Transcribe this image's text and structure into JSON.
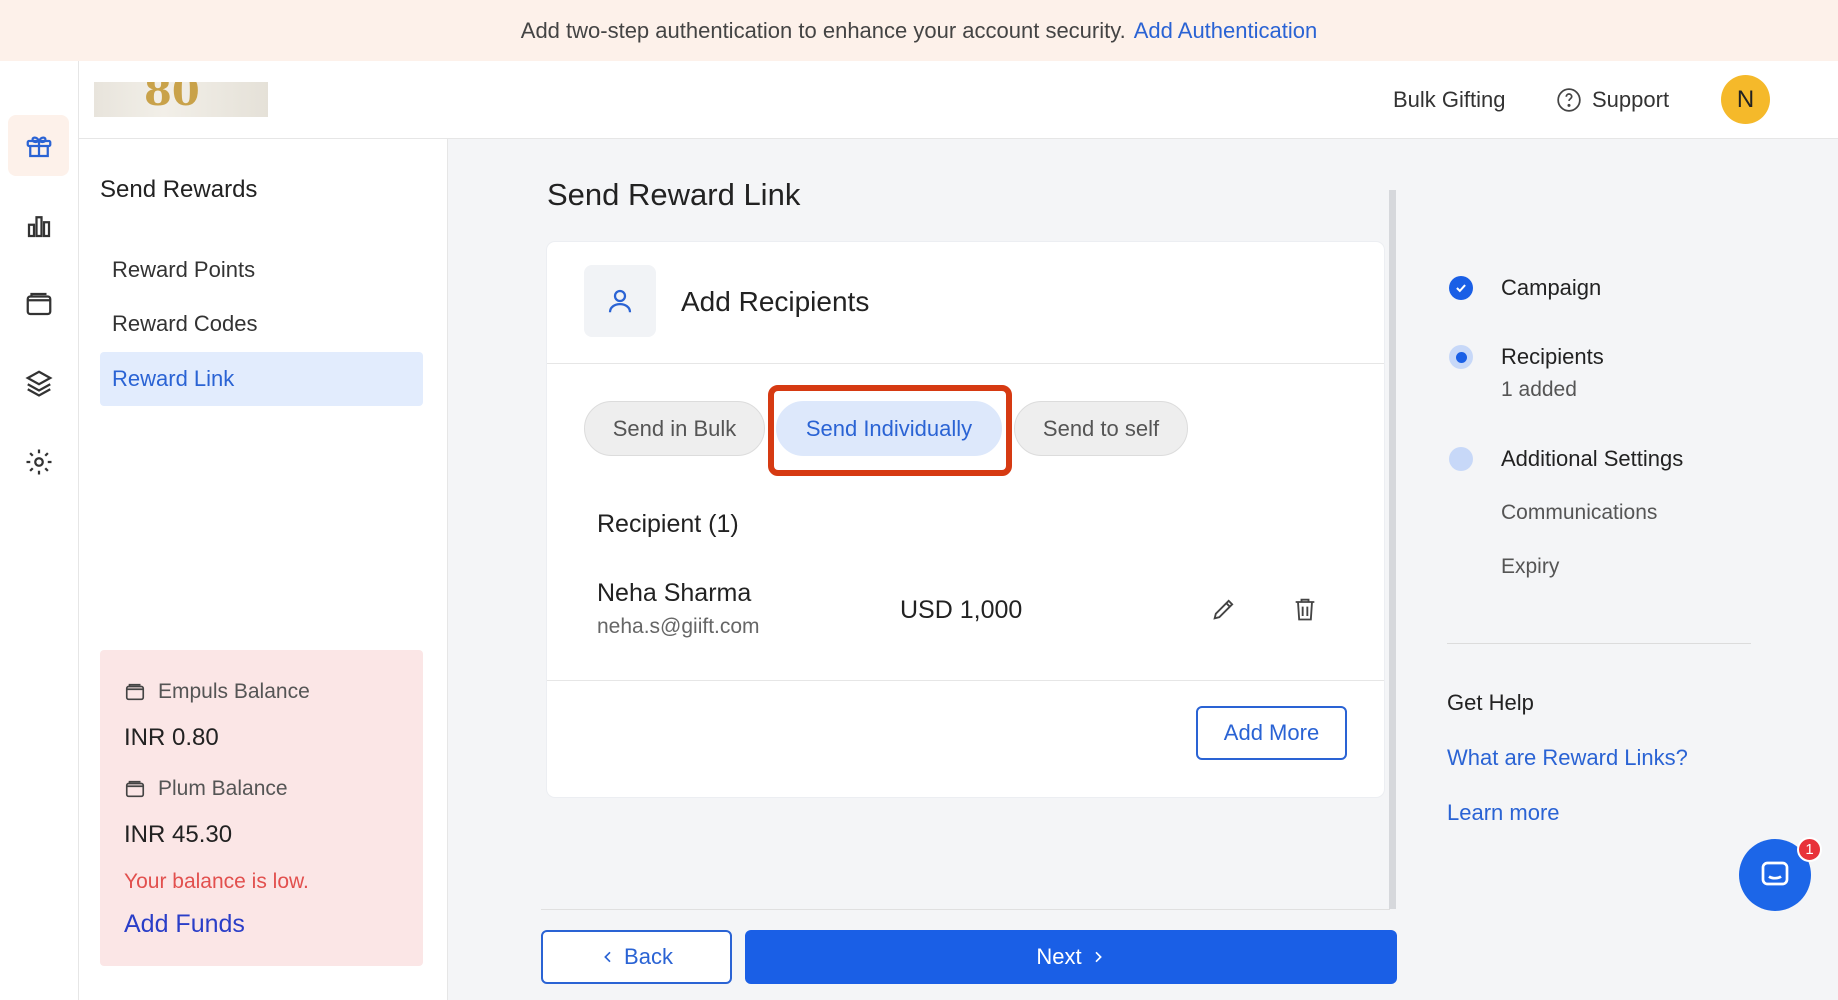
{
  "banner": {
    "text": "Add two-step authentication to enhance your account security.",
    "link": "Add Authentication"
  },
  "topbar": {
    "bulk_gifting": "Bulk Gifting",
    "support": "Support",
    "avatar_initial": "N",
    "logo_text": "80"
  },
  "rail": {
    "icons": [
      "gift-icon",
      "chart-icon",
      "wallet-icon",
      "layers-icon",
      "settings-icon"
    ]
  },
  "sidebar": {
    "title": "Send Rewards",
    "items": [
      {
        "label": "Reward Points"
      },
      {
        "label": "Reward Codes"
      },
      {
        "label": "Reward Link",
        "active": true
      }
    ]
  },
  "balance": {
    "empuls_label": "Empuls Balance",
    "empuls_value": "INR 0.80",
    "plum_label": "Plum Balance",
    "plum_value": "INR 45.30",
    "low_text": "Your balance is low.",
    "add_funds": "Add Funds"
  },
  "main": {
    "title": "Send Reward Link",
    "card_title": "Add Recipients",
    "tabs": [
      {
        "label": "Send in Bulk"
      },
      {
        "label": "Send Individually",
        "active": true
      },
      {
        "label": "Send to self"
      }
    ],
    "recipient_heading": "Recipient (1)",
    "recipient": {
      "name": "Neha Sharma",
      "email": "neha.s@giift.com",
      "amount": "USD 1,000"
    },
    "add_more": "Add More",
    "back": "Back",
    "next": "Next"
  },
  "steps": [
    {
      "label": "Campaign",
      "status": "done"
    },
    {
      "label": "Recipients",
      "sub": "1 added",
      "status": "current"
    },
    {
      "label": "Additional Settings",
      "status": "pending"
    },
    {
      "label": "Communications"
    },
    {
      "label": "Expiry"
    }
  ],
  "help": {
    "title": "Get Help",
    "link1": "What are Reward Links?",
    "link2": "Learn more"
  },
  "chat": {
    "badge": "1"
  },
  "colors": {
    "accent": "#2a63d4",
    "primary_button": "#1a5fe6",
    "highlight": "#d63a12",
    "warning": "#e2504e"
  }
}
